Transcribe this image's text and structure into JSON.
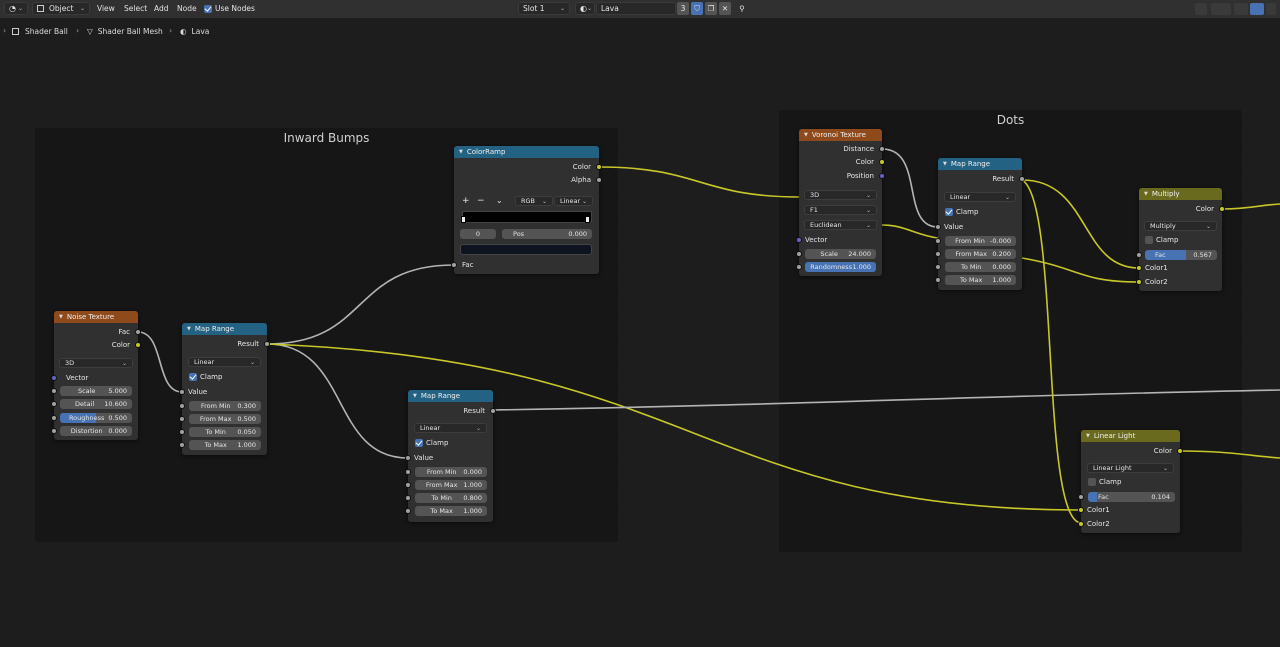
{
  "header": {
    "mode": "Object",
    "menus": [
      "View",
      "Select",
      "Add",
      "Node"
    ],
    "use_nodes": "Use Nodes",
    "slot": "Slot 1",
    "material": "Lava",
    "user_count": "3"
  },
  "breadcrumb": [
    "Shader Ball",
    "Shader Ball Mesh",
    "Lava"
  ],
  "frames": {
    "inward": "Inward Bumps",
    "dots": "Dots"
  },
  "nodes": {
    "noise": {
      "title": "Noise Texture",
      "out_fac": "Fac",
      "out_color": "Color",
      "dim": "3D",
      "vector": "Vector",
      "fields": [
        {
          "label": "Scale",
          "value": "5.000"
        },
        {
          "label": "Detail",
          "value": "10.600"
        },
        {
          "label": "Roughness",
          "value": "0.500"
        },
        {
          "label": "Distortion",
          "value": "0.000"
        }
      ]
    },
    "map1": {
      "title": "Map Range",
      "out": "Result",
      "interp": "Linear",
      "clamp": "Clamp",
      "value": "Value",
      "fields": [
        {
          "label": "From Min",
          "value": "0.300"
        },
        {
          "label": "From Max",
          "value": "0.500"
        },
        {
          "label": "To Min",
          "value": "0.050"
        },
        {
          "label": "To Max",
          "value": "1.000"
        }
      ]
    },
    "colorramp": {
      "title": "ColorRamp",
      "out_color": "Color",
      "out_alpha": "Alpha",
      "plus": "+",
      "minus": "−",
      "chev": "⌄",
      "mode": "RGB",
      "interp": "Linear",
      "index": "0",
      "pos_label": "Pos",
      "pos_value": "0.000",
      "fac": "Fac"
    },
    "map2": {
      "title": "Map Range",
      "out": "Result",
      "interp": "Linear",
      "clamp": "Clamp",
      "value": "Value",
      "fields": [
        {
          "label": "From Min",
          "value": "0.000"
        },
        {
          "label": "From Max",
          "value": "1.000"
        },
        {
          "label": "To Min",
          "value": "0.800"
        },
        {
          "label": "To Max",
          "value": "1.000"
        }
      ]
    },
    "voronoi": {
      "title": "Voronoi Texture",
      "out_distance": "Distance",
      "out_color": "Color",
      "out_position": "Position",
      "dim": "3D",
      "feature": "F1",
      "metric": "Euclidean",
      "vector": "Vector",
      "fields": [
        {
          "label": "Scale",
          "value": "24.000"
        },
        {
          "label": "Randomness",
          "value": "1.000"
        }
      ]
    },
    "map3": {
      "title": "Map Range",
      "out": "Result",
      "interp": "Linear",
      "clamp": "Clamp",
      "value": "Value",
      "fields": [
        {
          "label": "From Min",
          "value": "-0.000"
        },
        {
          "label": "From Max",
          "value": "0.200"
        },
        {
          "label": "To Min",
          "value": "0.000"
        },
        {
          "label": "To Max",
          "value": "1.000"
        }
      ]
    },
    "multiply": {
      "title": "Multiply",
      "out": "Color",
      "mode": "Multiply",
      "clamp": "Clamp",
      "fac_label": "Fac",
      "fac_value": "0.567",
      "fac_fraction": 0.567,
      "color1": "Color1",
      "color2": "Color2"
    },
    "linearlight": {
      "title": "Linear Light",
      "out": "Color",
      "mode": "Linear Light",
      "clamp": "Clamp",
      "fac_label": "Fac",
      "fac_value": "0.104",
      "fac_fraction": 0.104,
      "color1": "Color1",
      "color2": "Color2"
    }
  },
  "colors": {
    "wire_gray": "#b4b4b4",
    "wire_yellow": "#c7c729",
    "texture_header": "#8f4a1c",
    "converter_header": "#246283",
    "color_header": "#6a6a1e",
    "accent_blue": "#4772b3"
  }
}
